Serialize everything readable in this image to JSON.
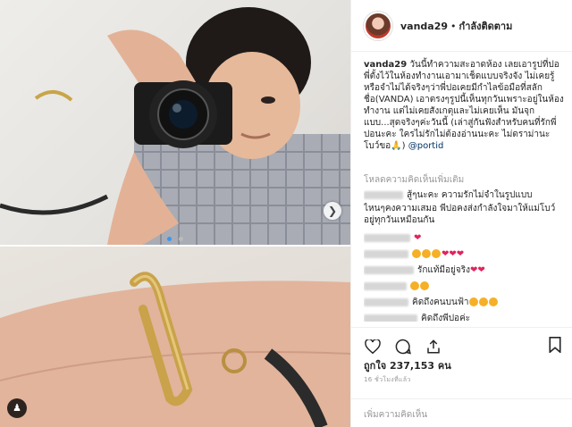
{
  "post": {
    "username": "vanda29",
    "separator": "•",
    "follow_status": "กำลังติดตาม",
    "caption_user": "vanda29",
    "caption_text": " วันนี้ทำความสะอาดห้อง เลยเอารูปที่ปอพี่ตั้งไว้ในห้องทำงานเอามาเช็ดแบบจริงจัง ไม่เคยรู้หรือจำไม่ได้จริงๆว่าพี่ปอเคยมีกำไลข้อมือที่สลักชื่อ(VANDA) เอาตรงๆรูปนี้เห็นทุกวันเพราะอยู่ในห้องทำงาน แต่ไม่เคยสังเกตุและไม่เคยเห็น มันจุกแบบ...สุดจริงๆค่ะวันนี้ (เล่าสู่กันฟังสำหรับคนที่รักพี่ปอนะคะ ใครไม่รักไม่ต้องอ่านนะคะ ไม่ดราม่านะ โบว์ขอ",
    "caption_mention": "@portid",
    "more_comments": "โหลดความคิดเห็นเพิ่มเติม",
    "likes": "ถูกใจ 237,153 คน",
    "timestamp": "16 ชั่วโมงที่แล้ว",
    "add_comment_placeholder": "เพิ่มความคิดเห็น"
  },
  "comments": [
    {
      "text": "สู้ๆนะคะ ความรักไม่จำในรูปแบบ"
    },
    {
      "text": "ไหนๆคงความเสมอ พี่ปอคงส่งกำลังใจมาให้แม่โบว์"
    },
    {
      "text": "อยู่ทุกวันเหมือนกัน"
    },
    {
      "text": "รักแท้มีอยู่จริง"
    },
    {
      "text": "คิดถึงคนบนฟ้า"
    },
    {
      "text": "คิดถึงพี่ปอค่ะ"
    }
  ],
  "icons": [
    "heart-icon",
    "comment-icon",
    "share-icon",
    "bookmark-icon",
    "chevron-right-icon",
    "user-tag-icon"
  ],
  "colors": {
    "link": "#003569",
    "heart": "#e0245e",
    "dot_active": "#3897f0"
  }
}
